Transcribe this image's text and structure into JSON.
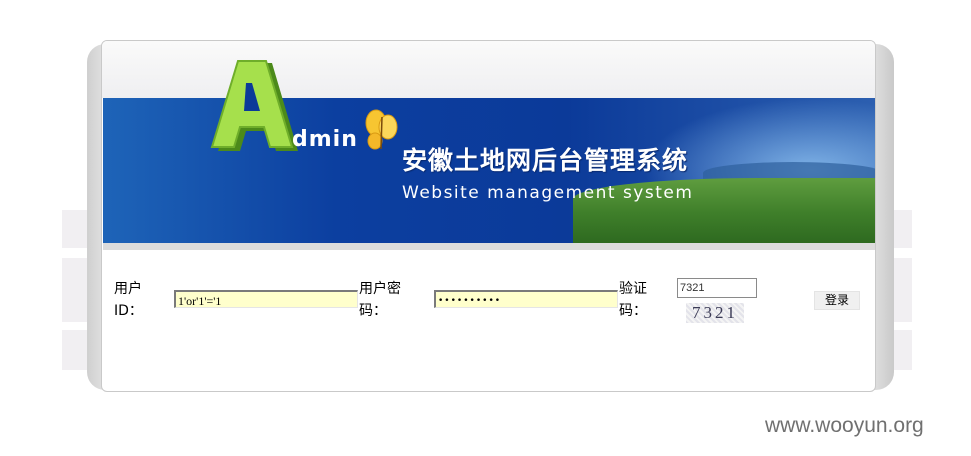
{
  "banner": {
    "logo_letter": "A",
    "logo_word": "dmin",
    "title_cn": "安徽土地网后台管理系统",
    "title_en": "Website management system"
  },
  "form": {
    "user_label": "用户ID：",
    "user_value": "1'or'1'='1",
    "password_label": "用户密码：",
    "password_value": "••••••••••",
    "captcha_label": "验证码：",
    "captcha_input_value": "7321",
    "captcha_image_text": "7321",
    "login_button": "登录"
  },
  "watermark": "www.wooyun.org",
  "colors": {
    "banner_blue": "#0b3a99",
    "input_bg": "#ffffcc",
    "logo_green": "#8fd63a"
  }
}
